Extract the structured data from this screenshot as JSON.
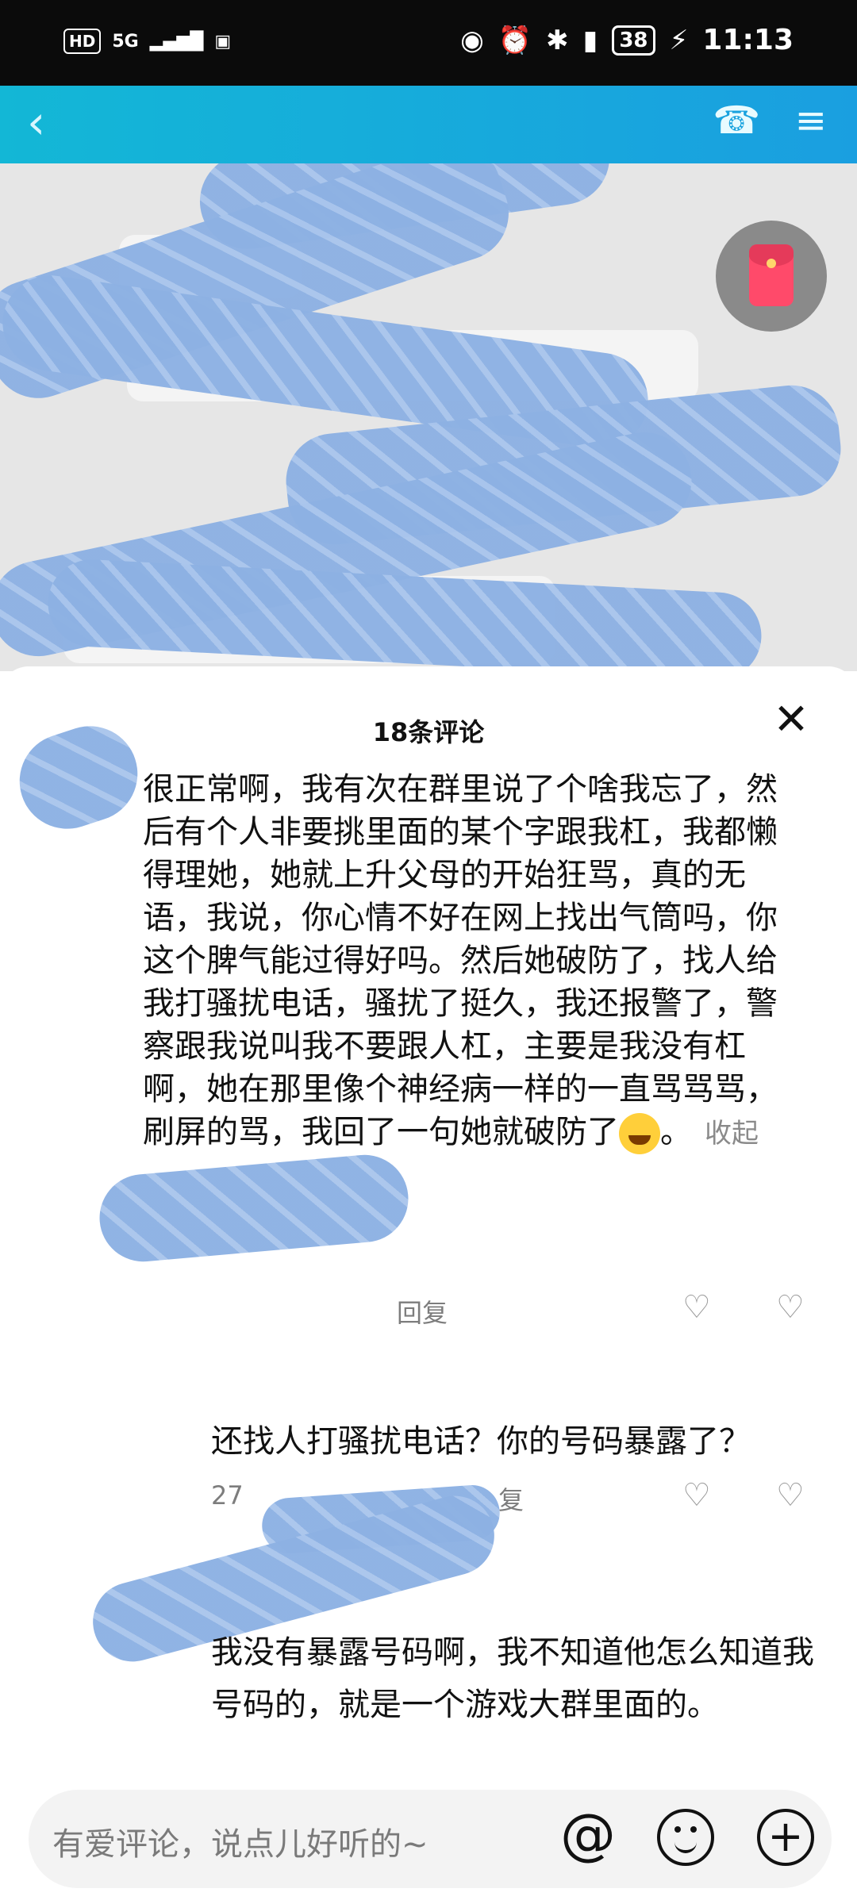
{
  "status_bar": {
    "hd": "HD",
    "network": "5G",
    "battery": "38",
    "time": "11:13",
    "icons": [
      "eye-icon",
      "alarm-icon",
      "bluetooth-icon",
      "vibrate-icon",
      "charging-icon"
    ]
  },
  "top_bar": {
    "back_icon": "chevron-left-icon",
    "phone_icon": "phone-icon",
    "menu_icon": "menu-icon"
  },
  "comments_sheet": {
    "title": "18条评论",
    "close_icon": "close-icon",
    "comments": [
      {
        "text": "很正常啊，我有次在群里说了个啥我忘了，然后有个人非要挑里面的某个字跟我杠，我都懒得理她，她就上升父母的开始狂骂，真的无语，我说，你心情不好在网上找出气筒吗，你这个脾气能过得好吗。然后她破防了，找人给我打骚扰电话，骚扰了挺久，我还报警了，警察跟我说叫我不要跟人杠，主要是我没有杠啊，她在那里像个神经病一样的一直骂骂骂，刷屏的骂，我回了一句她就破防了",
        "emoji": "laughing-crying-emoji",
        "trailing": "。",
        "fold_label": "收起",
        "reply_label": "回复"
      },
      {
        "text": "还找人打骚扰电话？你的号码暴露了？",
        "meta_left": "27",
        "meta_right": "复"
      },
      {
        "text": "我没有暴露号码啊，我不知道他怎么知道我号码的，就是一个游戏大群里面的。"
      }
    ]
  },
  "input_bar": {
    "placeholder": "有爱评论，说点儿好听的~",
    "at_symbol": "@",
    "plus_symbol": "+"
  },
  "colors": {
    "topbar": "#13b7d6",
    "redaction": "#8db1e3",
    "red_envelope": "#ff4a6a"
  }
}
